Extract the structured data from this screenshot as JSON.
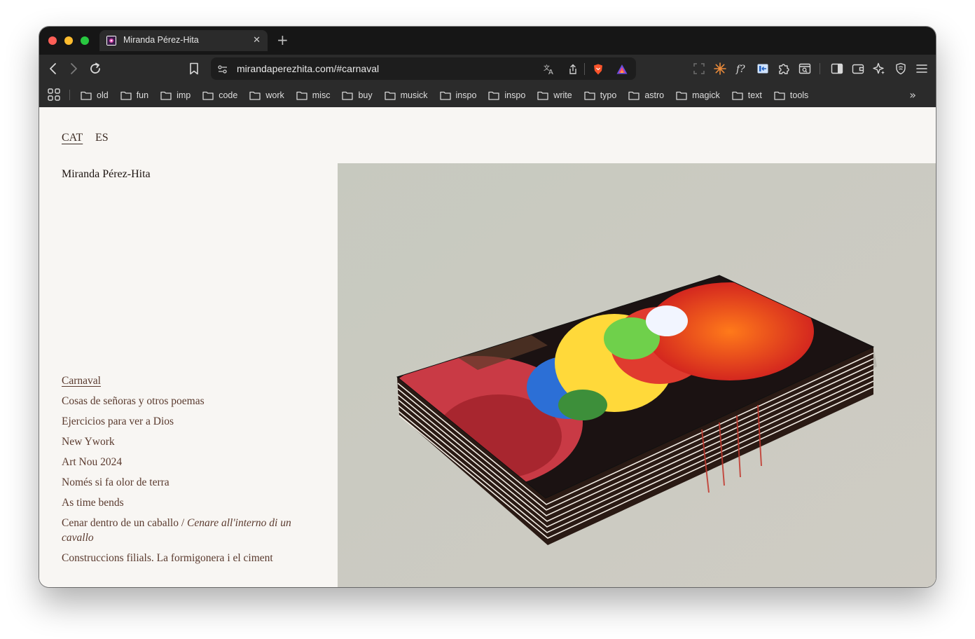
{
  "browser": {
    "tab_title": "Miranda Pérez-Hita",
    "url": "mirandaperezhita.com/#carnaval",
    "bookmarks": [
      "old",
      "fun",
      "imp",
      "code",
      "work",
      "misc",
      "buy",
      "musick",
      "inspo",
      "inspo",
      "write",
      "typo",
      "astro",
      "magick",
      "text",
      "tools"
    ]
  },
  "page": {
    "lang_cat": "CAT",
    "lang_es": "ES",
    "site_name": "Miranda Pérez-Hita",
    "projects": [
      {
        "label": "Carnaval"
      },
      {
        "label": "Cosas de señoras y otros poemas"
      },
      {
        "label": "Ejercicios para ver a Dios"
      },
      {
        "label": "New Ywork"
      },
      {
        "label": "Art Nou 2024"
      },
      {
        "label": "Només si fa olor de terra"
      },
      {
        "label": "As time bends"
      },
      {
        "label": "Cenar dentro de un caballo / ",
        "label_italic": "Cenare all'interno di un cavallo"
      },
      {
        "label": "Construccions filials. La formigonera i el ciment"
      }
    ]
  }
}
